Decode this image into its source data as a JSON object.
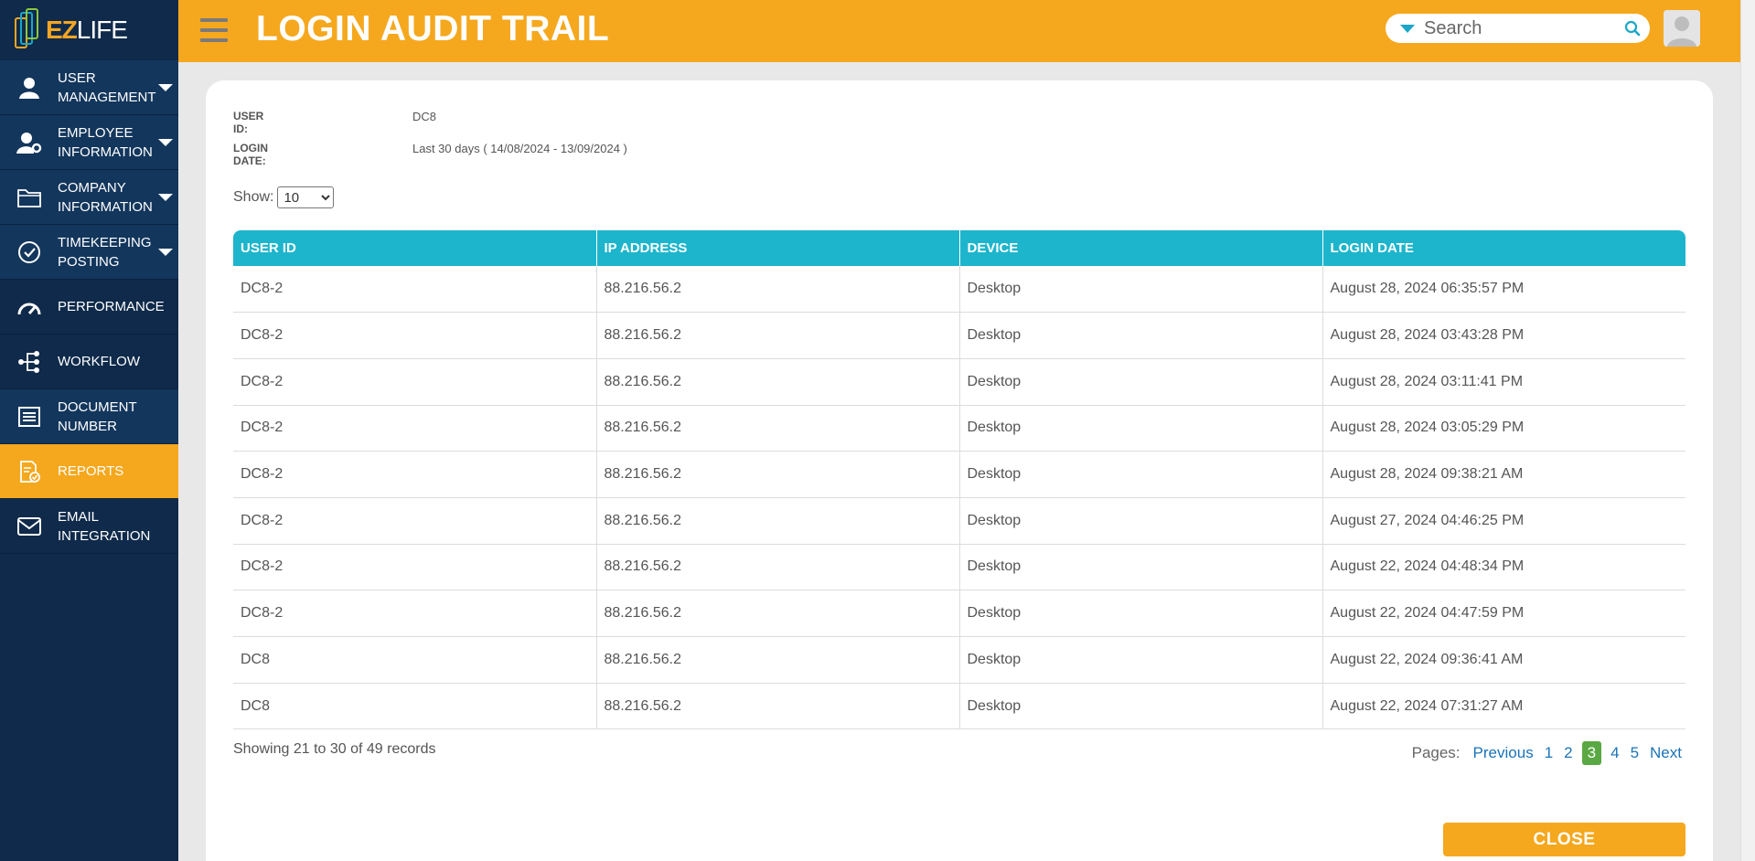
{
  "app": {
    "logo_ez": "EZ",
    "logo_life": "LIFE"
  },
  "sidebar": {
    "items": [
      {
        "label_line1": "USER",
        "label_line2": "MANAGEMENT",
        "icon": "user-icon",
        "caret": true
      },
      {
        "label_line1": "EMPLOYEE",
        "label_line2": "INFORMATION",
        "icon": "user-gear-icon",
        "caret": true
      },
      {
        "label_line1": "COMPANY",
        "label_line2": "INFORMATION",
        "icon": "folder-icon",
        "caret": true
      },
      {
        "label_line1": "TIMEKEEPING",
        "label_line2": "POSTING",
        "icon": "check-circle-icon",
        "caret": true
      },
      {
        "label_line1": "PERFORMANCE",
        "label_line2": "",
        "icon": "gauge-icon",
        "caret": false
      },
      {
        "label_line1": "WORKFLOW",
        "label_line2": "",
        "icon": "workflow-icon",
        "caret": false
      },
      {
        "label_line1": "DOCUMENT",
        "label_line2": "NUMBER",
        "icon": "list-icon",
        "caret": false
      },
      {
        "label_line1": "REPORTS",
        "label_line2": "",
        "icon": "report-icon",
        "caret": false,
        "active": true
      },
      {
        "label_line1": "EMAIL",
        "label_line2": "INTEGRATION",
        "icon": "mail-icon",
        "caret": false
      }
    ]
  },
  "header": {
    "title": "LOGIN AUDIT TRAIL",
    "search_placeholder": "Search"
  },
  "meta": {
    "user_id_label": "USER ID:",
    "user_id_value": "DC8",
    "login_date_label": "LOGIN DATE:",
    "login_date_value": "Last 30 days ( 14/08/2024 - 13/09/2024 )"
  },
  "show": {
    "label": "Show:",
    "value": "10"
  },
  "table": {
    "columns": [
      "USER ID",
      "IP ADDRESS",
      "DEVICE",
      "LOGIN DATE"
    ],
    "rows": [
      [
        "DC8-2",
        "88.216.56.2",
        "Desktop",
        "August 28, 2024 06:35:57 PM"
      ],
      [
        "DC8-2",
        "88.216.56.2",
        "Desktop",
        "August 28, 2024 03:43:28 PM"
      ],
      [
        "DC8-2",
        "88.216.56.2",
        "Desktop",
        "August 28, 2024 03:11:41 PM"
      ],
      [
        "DC8-2",
        "88.216.56.2",
        "Desktop",
        "August 28, 2024 03:05:29 PM"
      ],
      [
        "DC8-2",
        "88.216.56.2",
        "Desktop",
        "August 28, 2024 09:38:21 AM"
      ],
      [
        "DC8-2",
        "88.216.56.2",
        "Desktop",
        "August 27, 2024 04:46:25 PM"
      ],
      [
        "DC8-2",
        "88.216.56.2",
        "Desktop",
        "August 22, 2024 04:48:34 PM"
      ],
      [
        "DC8-2",
        "88.216.56.2",
        "Desktop",
        "August 22, 2024 04:47:59 PM"
      ],
      [
        "DC8",
        "88.216.56.2",
        "Desktop",
        "August 22, 2024 09:36:41 AM"
      ],
      [
        "DC8",
        "88.216.56.2",
        "Desktop",
        "August 22, 2024 07:31:27 AM"
      ]
    ]
  },
  "footer": {
    "showing_text": "Showing 21 to 30 of 49 records",
    "pages_label": "Pages:",
    "previous": "Previous",
    "pages": [
      "1",
      "2",
      "3",
      "4",
      "5"
    ],
    "current_page": "3",
    "next": "Next",
    "close_label": "CLOSE"
  },
  "colors": {
    "header_orange": "#f5a81e",
    "sidebar_navy": "#0f2a4a",
    "table_header_teal": "#1db5cc",
    "current_page_green": "#5aa843"
  }
}
